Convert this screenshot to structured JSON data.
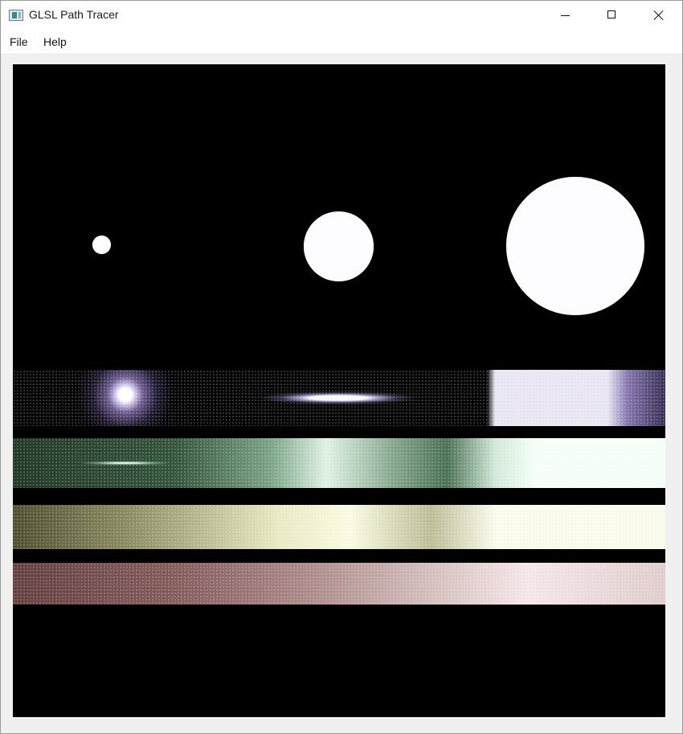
{
  "window": {
    "title": "GLSL Path Tracer",
    "icon": "app-icon",
    "controls": {
      "minimize_icon": "minimize-icon",
      "maximize_icon": "maximize-icon",
      "close_icon": "close-icon"
    }
  },
  "menubar": {
    "items": [
      {
        "label": "File"
      },
      {
        "label": "Help"
      }
    ]
  },
  "viewport": {
    "content": "path-traced render",
    "background": "#000000",
    "colors": {
      "sphere": "#fdfdff",
      "purple_band": "#c8bff0",
      "green_band": "#dff5e6",
      "yellow_band": "#f5f5d8",
      "red_band": "#ead2d2"
    }
  }
}
